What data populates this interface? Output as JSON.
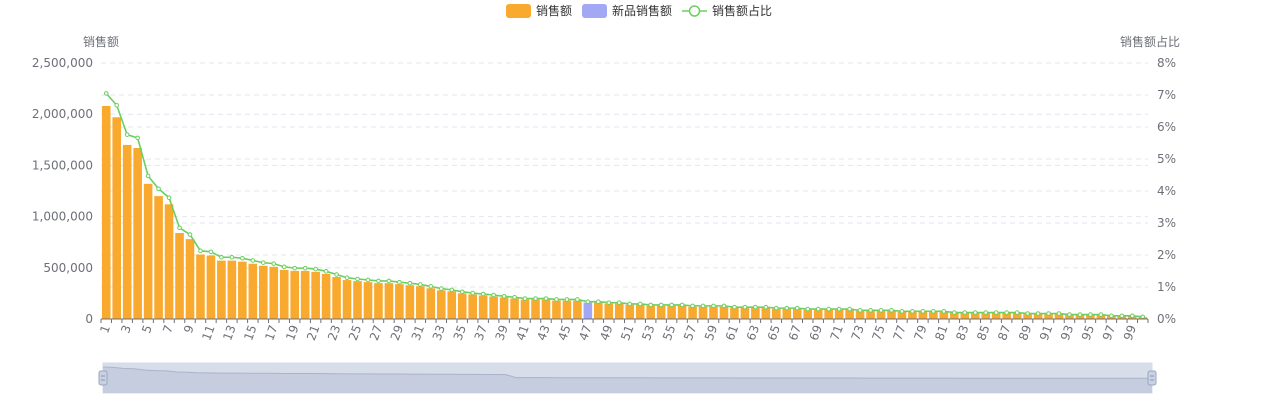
{
  "chart_data": {
    "type": "bar",
    "legend": {
      "placement": "top-center",
      "items": [
        {
          "label": "销售额",
          "color": "#f8a92e",
          "kind": "bar"
        },
        {
          "label": "新品销售额",
          "color": "#a3a8f4",
          "kind": "bar"
        },
        {
          "label": "销售额占比",
          "color": "#6ccf62",
          "kind": "line"
        }
      ]
    },
    "y_left": {
      "label": "销售额",
      "min": 0,
      "max": 2500000,
      "ticks": [
        "0",
        "500,000",
        "1,000,000",
        "1,500,000",
        "2,000,000",
        "2,500,000"
      ]
    },
    "y_right": {
      "label": "销售额占比",
      "min": 0,
      "max": 8,
      "ticks": [
        "0%",
        "1%",
        "2%",
        "3%",
        "4%",
        "5%",
        "6%",
        "7%",
        "8%"
      ]
    },
    "x": {
      "categories_count": 100,
      "tick_labels": [
        "1",
        "3",
        "5",
        "7",
        "9",
        "11",
        "13",
        "15",
        "17",
        "19",
        "21",
        "23",
        "25",
        "27",
        "29",
        "31",
        "33",
        "35",
        "37",
        "39",
        "41",
        "43",
        "45",
        "47",
        "49",
        "51",
        "53",
        "55",
        "57",
        "59",
        "61",
        "63",
        "65",
        "67",
        "69",
        "71",
        "73",
        "75",
        "77",
        "79",
        "81",
        "83",
        "85",
        "87",
        "89",
        "91",
        "93",
        "95",
        "97",
        "99"
      ]
    },
    "grid": true,
    "highlight_new_product_rank": 47,
    "series": [
      {
        "name": "销售额",
        "type": "bar",
        "values": [
          2080000,
          1970000,
          1700000,
          1670000,
          1320000,
          1200000,
          1120000,
          840000,
          780000,
          630000,
          620000,
          570000,
          570000,
          560000,
          540000,
          520000,
          510000,
          480000,
          470000,
          470000,
          460000,
          440000,
          410000,
          380000,
          370000,
          360000,
          350000,
          350000,
          340000,
          330000,
          320000,
          300000,
          280000,
          270000,
          250000,
          240000,
          230000,
          220000,
          210000,
          200000,
          190000,
          190000,
          190000,
          180000,
          180000,
          180000,
          160000,
          160000,
          150000,
          150000,
          140000,
          140000,
          130000,
          130000,
          130000,
          130000,
          120000,
          120000,
          120000,
          120000,
          110000,
          110000,
          110000,
          110000,
          100000,
          100000,
          100000,
          90000,
          90000,
          90000,
          90000,
          90000,
          80000,
          80000,
          80000,
          80000,
          70000,
          70000,
          70000,
          70000,
          70000,
          60000,
          60000,
          60000,
          60000,
          60000,
          60000,
          60000,
          50000,
          50000,
          50000,
          50000,
          40000,
          40000,
          40000,
          40000,
          30000,
          30000,
          30000,
          20000
        ]
      },
      {
        "name": "销售额占比",
        "type": "line",
        "axis": "right",
        "values": [
          7.05,
          6.68,
          5.76,
          5.66,
          4.47,
          4.07,
          3.79,
          2.85,
          2.64,
          2.13,
          2.1,
          1.93,
          1.93,
          1.9,
          1.83,
          1.76,
          1.73,
          1.63,
          1.59,
          1.59,
          1.56,
          1.49,
          1.39,
          1.29,
          1.25,
          1.22,
          1.19,
          1.19,
          1.15,
          1.12,
          1.08,
          1.02,
          0.95,
          0.91,
          0.85,
          0.81,
          0.78,
          0.75,
          0.71,
          0.68,
          0.64,
          0.64,
          0.64,
          0.61,
          0.61,
          0.61,
          0.54,
          0.54,
          0.51,
          0.51,
          0.47,
          0.47,
          0.44,
          0.44,
          0.44,
          0.44,
          0.41,
          0.41,
          0.41,
          0.41,
          0.37,
          0.37,
          0.37,
          0.37,
          0.34,
          0.34,
          0.34,
          0.31,
          0.31,
          0.31,
          0.31,
          0.31,
          0.27,
          0.27,
          0.27,
          0.27,
          0.24,
          0.24,
          0.24,
          0.24,
          0.24,
          0.2,
          0.2,
          0.2,
          0.2,
          0.2,
          0.2,
          0.2,
          0.17,
          0.17,
          0.17,
          0.17,
          0.14,
          0.14,
          0.14,
          0.14,
          0.1,
          0.1,
          0.1,
          0.07
        ]
      }
    ]
  }
}
